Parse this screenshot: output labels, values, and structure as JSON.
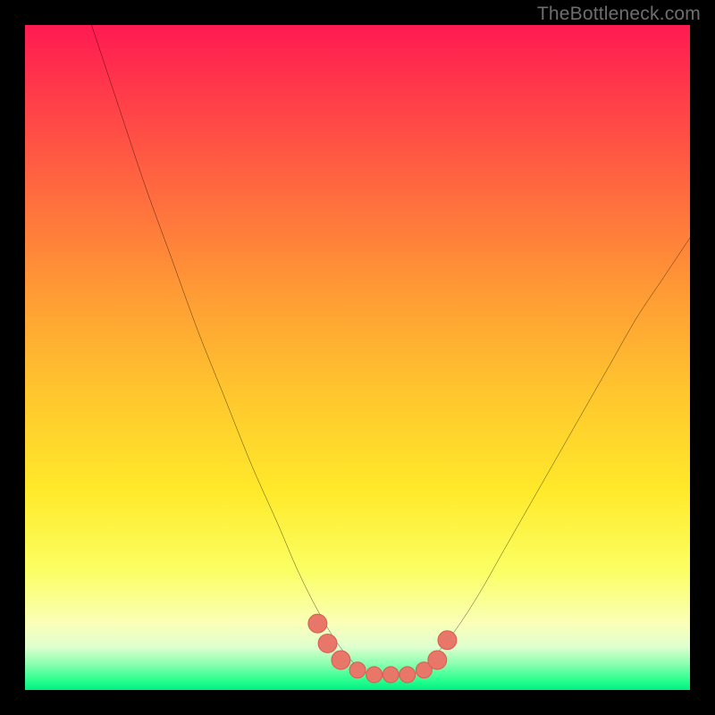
{
  "watermark": "TheBottleneck.com",
  "colors": {
    "frame": "#000000",
    "curve_stroke": "#000000",
    "marker_fill": "#e8776a",
    "marker_stroke": "#d85f54",
    "gradient_stops": [
      "#ff1a52",
      "#ff3a4a",
      "#ff6a3f",
      "#ff9a35",
      "#ffc52e",
      "#ffe92a",
      "#fbff63",
      "#faffb8",
      "#e0ffcf",
      "#8dffb0",
      "#2bff8f",
      "#00ef83"
    ]
  },
  "chart_data": {
    "type": "line",
    "title": "",
    "xlabel": "",
    "ylabel": "",
    "xlim": [
      0,
      100
    ],
    "ylim": [
      0,
      100
    ],
    "series": [
      {
        "name": "bottleneck-curve",
        "x": [
          10,
          14,
          18,
          22,
          26,
          30,
          34,
          38,
          41,
          44,
          47,
          50,
          52,
          55,
          58,
          60,
          64,
          68,
          72,
          76,
          80,
          84,
          88,
          92,
          96,
          100
        ],
        "y": [
          100,
          88,
          76,
          65,
          54,
          44,
          34,
          25,
          18,
          12,
          7,
          3.5,
          2.3,
          2.3,
          2.3,
          3.5,
          8,
          14,
          21,
          28,
          35,
          42,
          49,
          56,
          62,
          68
        ]
      }
    ],
    "markers": {
      "name": "highlight-points",
      "x": [
        44,
        45.5,
        47.5,
        50,
        52.5,
        55,
        57.5,
        60,
        62,
        63.5
      ],
      "y": [
        10,
        7,
        4.5,
        3,
        2.3,
        2.3,
        2.3,
        3,
        4.5,
        7.5
      ],
      "r": [
        1.4,
        1.4,
        1.4,
        1.2,
        1.2,
        1.2,
        1.2,
        1.2,
        1.4,
        1.4
      ]
    }
  }
}
